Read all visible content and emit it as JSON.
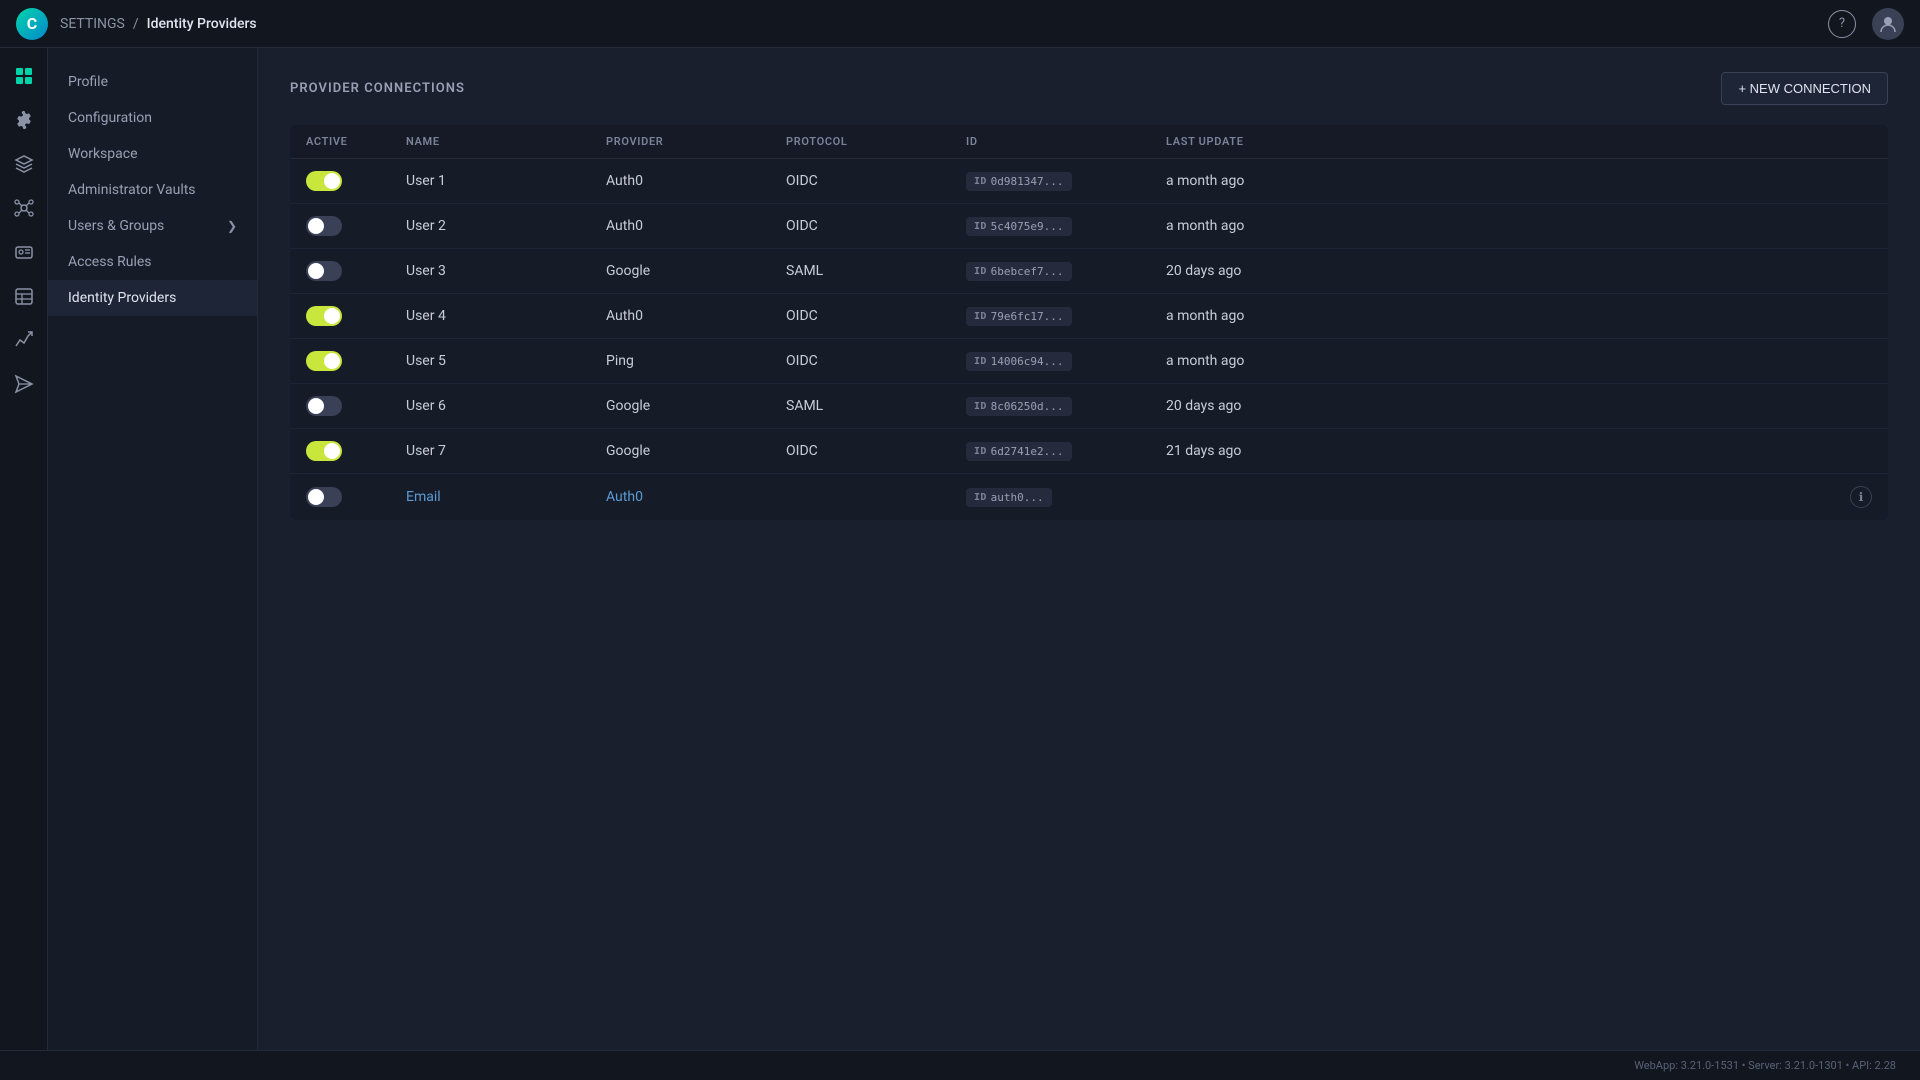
{
  "topbar": {
    "settings_label": "SETTINGS",
    "separator": "/",
    "page_label": "Identity Providers",
    "help_icon": "?",
    "logo_letter": "C"
  },
  "sidebar_icons": [
    {
      "id": "home-icon",
      "symbol": "⊞",
      "active": false
    },
    {
      "id": "settings-icon",
      "symbol": "✦",
      "active": true
    },
    {
      "id": "layers-icon",
      "symbol": "⬡",
      "active": false
    },
    {
      "id": "nodes-icon",
      "symbol": "◈",
      "active": false
    },
    {
      "id": "id-icon",
      "symbol": "▣",
      "active": false
    },
    {
      "id": "table-icon",
      "symbol": "▤",
      "active": false
    },
    {
      "id": "chart-icon",
      "symbol": "↗",
      "active": false
    },
    {
      "id": "send-icon",
      "symbol": "▶",
      "active": false
    }
  ],
  "nav": {
    "items": [
      {
        "id": "profile",
        "label": "Profile",
        "active": false,
        "has_chevron": false
      },
      {
        "id": "configuration",
        "label": "Configuration",
        "active": false,
        "has_chevron": false
      },
      {
        "id": "workspace",
        "label": "Workspace",
        "active": false,
        "has_chevron": false
      },
      {
        "id": "administrator-vaults",
        "label": "Administrator Vaults",
        "active": false,
        "has_chevron": false
      },
      {
        "id": "users-groups",
        "label": "Users & Groups",
        "active": false,
        "has_chevron": true
      },
      {
        "id": "access-rules",
        "label": "Access Rules",
        "active": false,
        "has_chevron": false
      },
      {
        "id": "identity-providers",
        "label": "Identity Providers",
        "active": true,
        "has_chevron": false
      }
    ]
  },
  "content": {
    "section_title": "PROVIDER CONNECTIONS",
    "new_connection_label": "+ NEW CONNECTION",
    "table": {
      "headers": [
        "ACTIVE",
        "NAME",
        "PROVIDER",
        "PROTOCOL",
        "ID",
        "LAST UPDATE",
        ""
      ],
      "rows": [
        {
          "active": true,
          "name": "User 1",
          "name_is_link": false,
          "provider": "Auth0",
          "protocol": "OIDC",
          "id": "0d981347...",
          "last_update": "a month ago",
          "has_info": false
        },
        {
          "active": false,
          "name": "User 2",
          "name_is_link": false,
          "provider": "Auth0",
          "protocol": "OIDC",
          "id": "5c4075e9...",
          "last_update": "a month ago",
          "has_info": false
        },
        {
          "active": false,
          "name": "User 3",
          "name_is_link": false,
          "provider": "Google",
          "protocol": "SAML",
          "id": "6bebcef7...",
          "last_update": "20 days ago",
          "has_info": false
        },
        {
          "active": true,
          "name": "User 4",
          "name_is_link": false,
          "provider": "Auth0",
          "protocol": "OIDC",
          "id": "79e6fc17...",
          "last_update": "a month ago",
          "has_info": false
        },
        {
          "active": true,
          "name": "User 5",
          "name_is_link": false,
          "provider": "Ping",
          "protocol": "OIDC",
          "id": "14006c94...",
          "last_update": "a month ago",
          "has_info": false
        },
        {
          "active": false,
          "name": "User 6",
          "name_is_link": false,
          "provider": "Google",
          "protocol": "SAML",
          "id": "8c06250d...",
          "last_update": "20 days ago",
          "has_info": false
        },
        {
          "active": true,
          "name": "User 7",
          "name_is_link": false,
          "provider": "Google",
          "protocol": "OIDC",
          "id": "6d2741e2...",
          "last_update": "21 days ago",
          "has_info": false
        },
        {
          "active": false,
          "name": "Email",
          "name_is_link": true,
          "provider": "Auth0",
          "provider_is_link": true,
          "protocol": "",
          "id": "auth0...",
          "last_update": "",
          "has_info": true
        }
      ]
    }
  },
  "footer": {
    "text": "WebApp: 3.21.0-1531 • Server: 3.21.0-1301 • API: 2.28"
  }
}
